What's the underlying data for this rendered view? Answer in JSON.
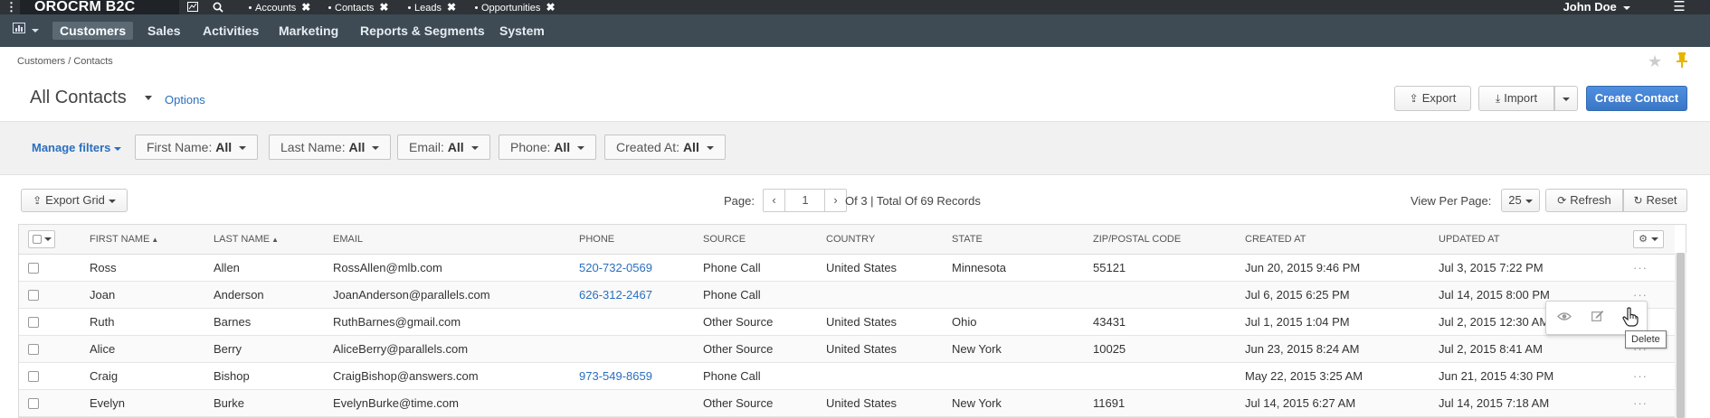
{
  "topbar": {
    "brand": "OROCRM B2C",
    "tabs": [
      {
        "label": "Accounts"
      },
      {
        "label": "Contacts"
      },
      {
        "label": "Leads"
      },
      {
        "label": "Opportunities"
      }
    ],
    "user": "John Doe"
  },
  "nav": {
    "items": [
      "Customers",
      "Sales",
      "Activities",
      "Marketing",
      "Reports & Segments",
      "System"
    ]
  },
  "breadcrumb": "Customers / Contacts",
  "page": {
    "title": "All Contacts",
    "options": "Options",
    "export": "Export",
    "import": "Import",
    "create": "Create Contact"
  },
  "filters": {
    "manage": "Manage filters",
    "items": [
      {
        "label": "First Name:",
        "value": "All"
      },
      {
        "label": "Last Name:",
        "value": "All"
      },
      {
        "label": "Email:",
        "value": "All"
      },
      {
        "label": "Phone:",
        "value": "All"
      },
      {
        "label": "Created At:",
        "value": "All"
      }
    ]
  },
  "gridbar": {
    "export_grid": "Export Grid",
    "page_label": "Page:",
    "page": "1",
    "records": "Of 3 | Total Of 69 Records",
    "view_per_page": "View Per Page:",
    "per_page": "25",
    "refresh": "Refresh",
    "reset": "Reset"
  },
  "table": {
    "columns": [
      "First Name",
      "Last Name",
      "Email",
      "Phone",
      "Source",
      "Country",
      "State",
      "Zip/Postal Code",
      "Created At",
      "Updated At"
    ],
    "rows": [
      {
        "first": "Ross",
        "last": "Allen",
        "email": "RossAllen@mlb.com",
        "phone": "520-732-0569",
        "source": "Phone Call",
        "country": "United States",
        "state": "Minnesota",
        "zip": "55121",
        "created": "Jun 20, 2015 9:46 PM",
        "updated": "Jul 3, 2015 7:22 PM"
      },
      {
        "first": "Joan",
        "last": "Anderson",
        "email": "JoanAnderson@parallels.com",
        "phone": "626-312-2467",
        "source": "Phone Call",
        "country": "",
        "state": "",
        "zip": "",
        "created": "Jul 6, 2015 6:25 PM",
        "updated": "Jul 14, 2015 8:00 PM"
      },
      {
        "first": "Ruth",
        "last": "Barnes",
        "email": "RuthBarnes@gmail.com",
        "phone": "",
        "source": "Other Source",
        "country": "United States",
        "state": "Ohio",
        "zip": "43431",
        "created": "Jul 1, 2015 1:04 PM",
        "updated": "Jul 2, 2015 12:30 AM"
      },
      {
        "first": "Alice",
        "last": "Berry",
        "email": "AliceBerry@parallels.com",
        "phone": "",
        "source": "Other Source",
        "country": "United States",
        "state": "New York",
        "zip": "10025",
        "created": "Jun 23, 2015 8:24 AM",
        "updated": "Jul 2, 2015 8:41 AM"
      },
      {
        "first": "Craig",
        "last": "Bishop",
        "email": "CraigBishop@answers.com",
        "phone": "973-549-8659",
        "source": "Phone Call",
        "country": "",
        "state": "",
        "zip": "",
        "created": "May 22, 2015 3:25 AM",
        "updated": "Jun 21, 2015 4:30 PM"
      },
      {
        "first": "Evelyn",
        "last": "Burke",
        "email": "EvelynBurke@time.com",
        "phone": "",
        "source": "Other Source",
        "country": "United States",
        "state": "New York",
        "zip": "11691",
        "created": "Jul 14, 2015 6:27 AM",
        "updated": "Jul 14, 2015 7:18 AM"
      }
    ]
  },
  "tooltip": "Delete",
  "icons": {
    "row_actions": "ellipsis-icon",
    "popup": [
      "eye-icon",
      "edit-icon",
      "delete-icon"
    ]
  },
  "colors": {
    "primary": "#3a76c6",
    "link": "#2a6fbf",
    "nav": "#3e4b55",
    "topbar": "#2f3338"
  }
}
